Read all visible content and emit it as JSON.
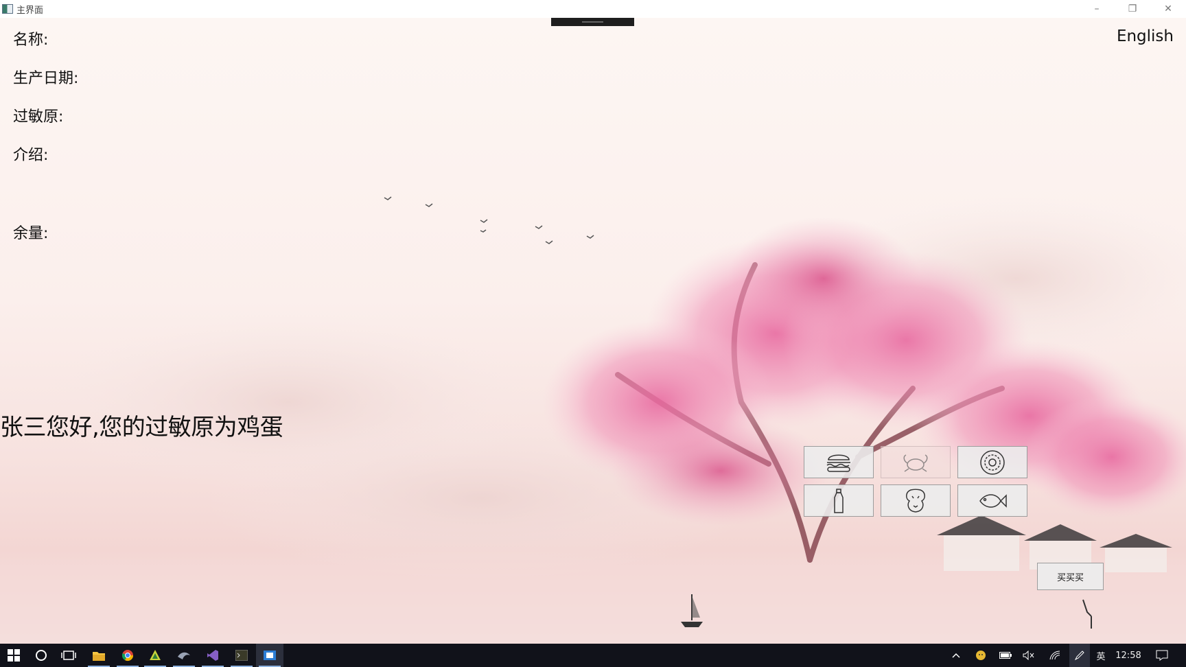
{
  "window": {
    "title": "主界面",
    "minimize": "–",
    "restore": "❐",
    "close": "✕"
  },
  "fields": {
    "name": "名称:",
    "date": "生产日期:",
    "allergen": "过敏原:",
    "intro": "介绍:",
    "remaining": "余量:"
  },
  "language_toggle": "English",
  "greeting": "张三您好,您的过敏原为鸡蛋",
  "food_buttons": [
    {
      "icon": "burger-icon",
      "faded": false
    },
    {
      "icon": "crab-icon",
      "faded": true
    },
    {
      "icon": "egg-icon",
      "faded": false
    },
    {
      "icon": "milk-bottle-icon",
      "faded": false
    },
    {
      "icon": "peanut-icon",
      "faded": false
    },
    {
      "icon": "fish-icon",
      "faded": false
    }
  ],
  "buy_button": "买买买",
  "taskbar": {
    "ime": "英",
    "clock": "12:58"
  }
}
